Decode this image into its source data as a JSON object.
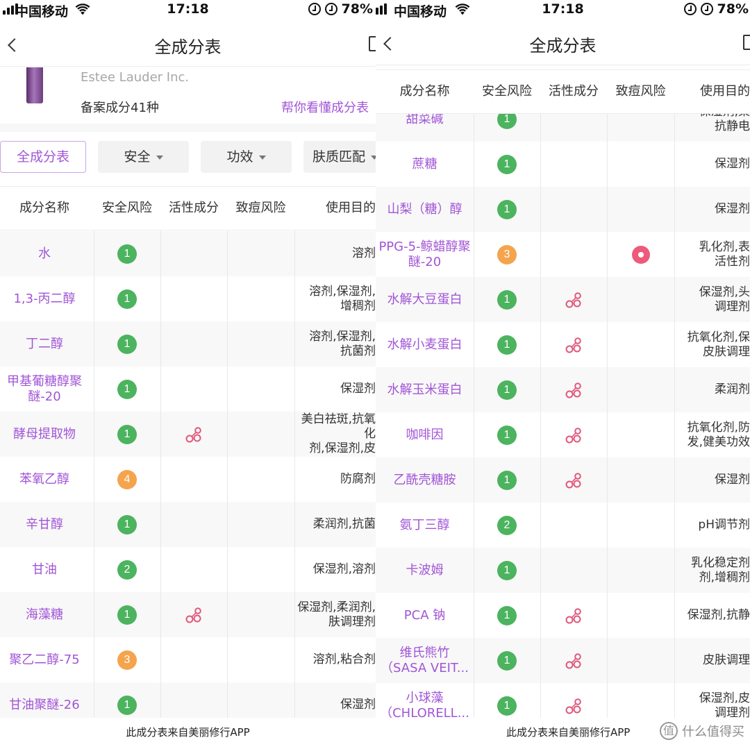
{
  "left": {
    "status": {
      "carrier": "中国移动",
      "time": "17:18",
      "battery": "78%"
    },
    "nav_title": "全成分表",
    "product": {
      "brand": "Estee Lauder Inc.",
      "count_text": "备案成分41种",
      "help_link": "帮你看懂成分表"
    },
    "filters": [
      "全成分表",
      "安全",
      "功效",
      "肤质匹配"
    ],
    "headers": [
      "成分名称",
      "安全风险",
      "活性成分",
      "致痘风险",
      "使用目的"
    ],
    "rows": [
      {
        "name": "水",
        "safety": "1",
        "active": false,
        "acne": false,
        "purpose": "溶剂"
      },
      {
        "name": "1,3-丙二醇",
        "safety": "1",
        "active": false,
        "acne": false,
        "purpose": "溶剂,保湿剂,\n增稠剂"
      },
      {
        "name": "丁二醇",
        "safety": "1",
        "active": false,
        "acne": false,
        "purpose": "溶剂,保湿剂,\n抗菌剂"
      },
      {
        "name": "甲基葡糖醇聚醚-20",
        "safety": "1",
        "active": false,
        "acne": false,
        "purpose": "保湿剂"
      },
      {
        "name": "酵母提取物",
        "safety": "1",
        "active": true,
        "acne": false,
        "purpose": "美白祛斑,抗氧化\n剂,保湿剂,皮"
      },
      {
        "name": "苯氧乙醇",
        "safety": "4",
        "active": false,
        "acne": false,
        "purpose": "防腐剂"
      },
      {
        "name": "辛甘醇",
        "safety": "1",
        "active": false,
        "acne": false,
        "purpose": "柔润剂,抗菌"
      },
      {
        "name": "甘油",
        "safety": "2",
        "active": false,
        "acne": false,
        "purpose": "保湿剂,溶剂"
      },
      {
        "name": "海藻糖",
        "safety": "1",
        "active": true,
        "acne": false,
        "purpose": "保湿剂,柔润剂,\n肤调理剂"
      },
      {
        "name": "聚乙二醇-75",
        "safety": "3",
        "active": false,
        "acne": false,
        "purpose": "溶剂,粘合剂"
      },
      {
        "name": "甘油聚醚-26",
        "safety": "1",
        "active": false,
        "acne": false,
        "purpose": "保湿剂"
      }
    ],
    "footer": "此成分表来自美丽修行APP"
  },
  "right": {
    "status": {
      "carrier": "中国移动",
      "time": "17:18",
      "battery": "78%"
    },
    "nav_title": "全成分表",
    "headers": [
      "成分名称",
      "安全风险",
      "活性成分",
      "致痘风险",
      "使用目的"
    ],
    "rows": [
      {
        "name": "甜菜碱",
        "safety": "1",
        "active": false,
        "acne": false,
        "purpose": "保湿剂,柔\n抗静电"
      },
      {
        "name": "蔗糖",
        "safety": "1",
        "active": false,
        "acne": false,
        "purpose": "保湿剂"
      },
      {
        "name": "山梨（糖）醇",
        "safety": "1",
        "active": false,
        "acne": false,
        "purpose": "保湿剂"
      },
      {
        "name": "PPG-5-鲸蜡醇聚醚-20",
        "safety": "3",
        "active": false,
        "acne": true,
        "purpose": "乳化剂,表\n活性剂"
      },
      {
        "name": "水解大豆蛋白",
        "safety": "1",
        "active": true,
        "acne": false,
        "purpose": "保湿剂,头\n调理剂"
      },
      {
        "name": "水解小麦蛋白",
        "safety": "1",
        "active": true,
        "acne": false,
        "purpose": "抗氧化剂,保\n皮肤调理"
      },
      {
        "name": "水解玉米蛋白",
        "safety": "1",
        "active": true,
        "acne": false,
        "purpose": "柔润剂"
      },
      {
        "name": "咖啡因",
        "safety": "1",
        "active": true,
        "acne": false,
        "purpose": "抗氧化剂,防\n发,健美功效"
      },
      {
        "name": "乙酰壳糖胺",
        "safety": "1",
        "active": true,
        "acne": false,
        "purpose": "保湿剂"
      },
      {
        "name": "氨丁三醇",
        "safety": "2",
        "active": false,
        "acne": false,
        "purpose": "pH调节剂"
      },
      {
        "name": "卡波姆",
        "safety": "1",
        "active": false,
        "acne": false,
        "purpose": "乳化稳定剂\n剂,增稠剂"
      },
      {
        "name": "PCA 钠",
        "safety": "1",
        "active": true,
        "acne": false,
        "purpose": "保湿剂,抗静"
      },
      {
        "name": "维氏熊竹（SASA VEIT...",
        "safety": "1",
        "active": true,
        "acne": false,
        "purpose": "皮肤调理"
      },
      {
        "name": "小球藻（CHLORELL...",
        "safety": "1",
        "active": true,
        "acne": false,
        "purpose": "保湿剂,皮\n调理剂"
      }
    ],
    "footer": "此成分表来自美丽修行APP",
    "watermark": "什么值得买"
  },
  "colors": {
    "accent": "#a155d6",
    "safe": "#4cb35f",
    "warn": "#f5a44e",
    "acne": "#ee5a7a"
  }
}
